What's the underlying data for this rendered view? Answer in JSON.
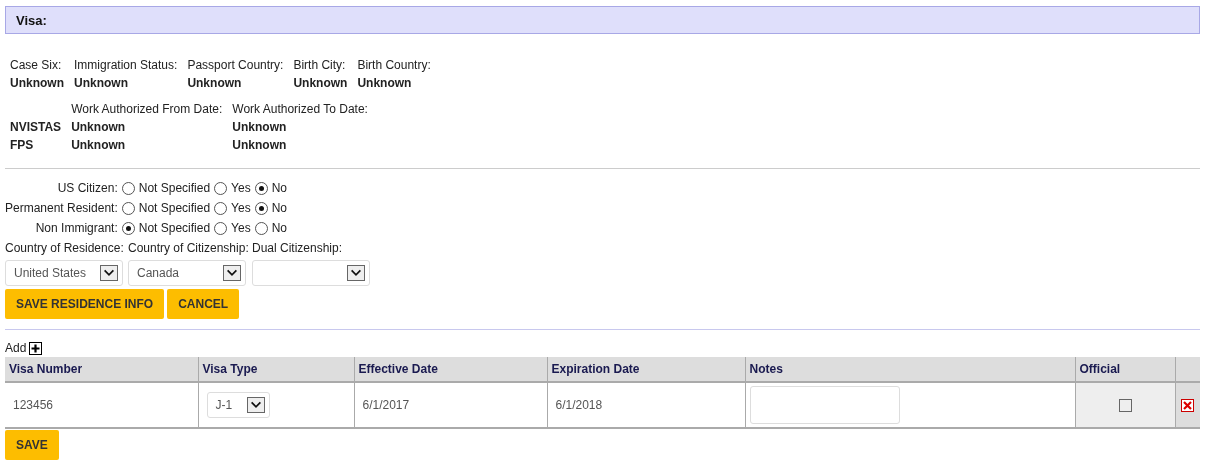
{
  "section_title": "Visa:",
  "info_fields": [
    {
      "label": "Case Six:",
      "value": "Unknown"
    },
    {
      "label": "Immigration Status:",
      "value": "Unknown"
    },
    {
      "label": "Passport Country:",
      "value": "Unknown"
    },
    {
      "label": "Birth City:",
      "value": "Unknown"
    },
    {
      "label": "Birth Country:",
      "value": "Unknown"
    }
  ],
  "work_auth": {
    "columns": [
      "Work Authorized From Date:",
      "Work Authorized To Date:"
    ],
    "rows": [
      {
        "source": "NVISTAS",
        "values": [
          "Unknown",
          "Unknown"
        ]
      },
      {
        "source": "FPS",
        "values": [
          "Unknown",
          "Unknown"
        ]
      }
    ]
  },
  "residence": [
    {
      "label": "US Citizen:",
      "options": [
        {
          "label": "Not Specified",
          "selected": false
        },
        {
          "label": "Yes",
          "selected": false
        },
        {
          "label": "No",
          "selected": true
        }
      ]
    },
    {
      "label": "Permanent Resident:",
      "options": [
        {
          "label": "Not Specified",
          "selected": false
        },
        {
          "label": "Yes",
          "selected": false
        },
        {
          "label": "No",
          "selected": true
        }
      ]
    },
    {
      "label": "Non Immigrant:",
      "options": [
        {
          "label": "Not Specified",
          "selected": true
        },
        {
          "label": "Yes",
          "selected": false
        },
        {
          "label": "No",
          "selected": false
        }
      ]
    }
  ],
  "country_fields": [
    {
      "label": "Country of Residence:",
      "value": "United States"
    },
    {
      "label": "Country of Citizenship:",
      "value": "Canada"
    },
    {
      "label": "Dual Citizenship:"
    }
  ],
  "buttons": [
    "SAVE RESIDENCE INFO",
    "CANCEL"
  ],
  "add_label": "Add",
  "visa_table": {
    "columns": [
      "Visa Number",
      "Visa Type",
      "Effective Date",
      "Expiration Date",
      "Notes",
      "Official"
    ],
    "rows": [
      {
        "visa_number": "123456",
        "visa_type": "J-1",
        "effective_date": "6/1/2017",
        "expiration_date": "6/1/2018",
        "official": false
      }
    ]
  },
  "save_button": "SAVE"
}
